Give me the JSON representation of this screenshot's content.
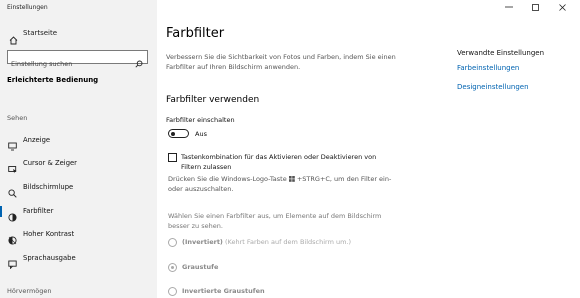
{
  "app": {
    "title": "Einstellungen"
  },
  "sidebar": {
    "home_label": "Startseite",
    "search_placeholder": "Einstellung suchen",
    "category_title": "Erleichterte Bedienung",
    "group_sehen": "Sehen",
    "items": [
      {
        "label": "Anzeige",
        "icon": "display-icon"
      },
      {
        "label": "Cursor & Zeiger",
        "icon": "cursor-icon"
      },
      {
        "label": "Bildschirmlupe",
        "icon": "magnifier-icon"
      },
      {
        "label": "Farbfilter",
        "icon": "color-filter-icon",
        "active": true
      },
      {
        "label": "Hoher Kontrast",
        "icon": "high-contrast-icon"
      },
      {
        "label": "Sprachausgabe",
        "icon": "narrator-icon"
      }
    ],
    "group_hoeren": "Hörvermögen"
  },
  "main": {
    "title": "Farbfilter",
    "description": "Verbessern Sie die Sichtbarkeit von Fotos und Farben, indem Sie einen Farbfilter auf Ihren Bildschirm anwenden.",
    "section_title": "Farbfilter verwenden",
    "toggle_label": "Farbfilter einschalten",
    "toggle_state": "Aus",
    "checkbox_label": "Tastenkombination für das Aktivieren oder Deaktivieren von Filtern zulassen",
    "checkbox_help_before": "Drücken Sie die Windows-Logo-Taste ",
    "checkbox_help_after": " +STRG+C, um den Filter ein- oder auszuschalten.",
    "choose_text": "Wählen Sie einen Farbfilter aus, um Elemente auf dem Bildschirm besser zu sehen.",
    "options": [
      {
        "label": "(Invertiert)",
        "sub": "(Kehrt Farben auf dem Bildschirm um.)",
        "selected": false
      },
      {
        "label": "Graustufe",
        "sub": "",
        "selected": true
      },
      {
        "label": "Invertierte Graustufen",
        "sub": "",
        "selected": false
      }
    ]
  },
  "related": {
    "title": "Verwandte Einstellungen",
    "links": [
      "Farbeinstellungen",
      "Designeinstellungen"
    ]
  },
  "colors": {
    "accent": "#0063b1",
    "sidebar_bg": "#f2f2f2"
  }
}
